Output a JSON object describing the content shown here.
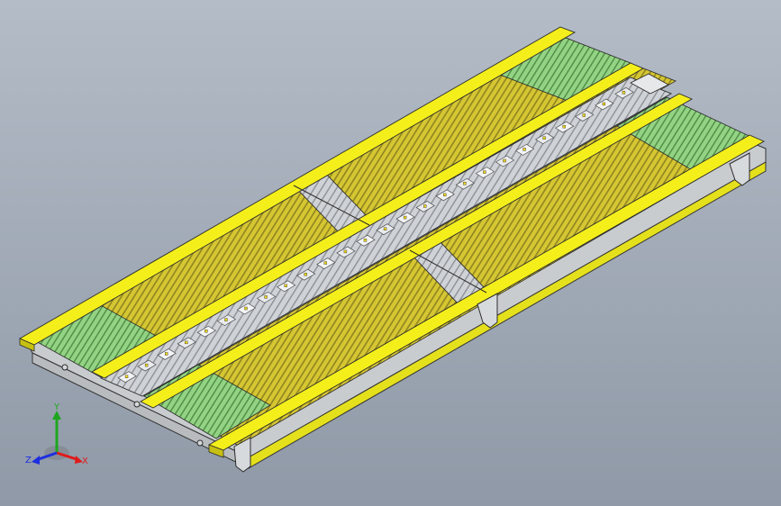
{
  "colors": {
    "background_top": "#b4bcc7",
    "background_bottom": "#8f99a7",
    "yellow_rail": "#f2ee18",
    "yellow_grating": "#cdbf2a",
    "green_zone": "#8fcf7e",
    "steel_gray": "#c4c8cc",
    "dark_slot": "#7c7e82",
    "edge_line": "#2b2b2b",
    "axis_x": "#e01b1b",
    "axis_y": "#1fa61f",
    "axis_z": "#1d2ee0"
  },
  "model": {
    "description_icon": "conveyor-roller-table-icon",
    "rail_count": 4,
    "grating_panels": 2
  },
  "triad": {
    "x_label": "X",
    "y_label": "Y",
    "z_label": "Z"
  }
}
